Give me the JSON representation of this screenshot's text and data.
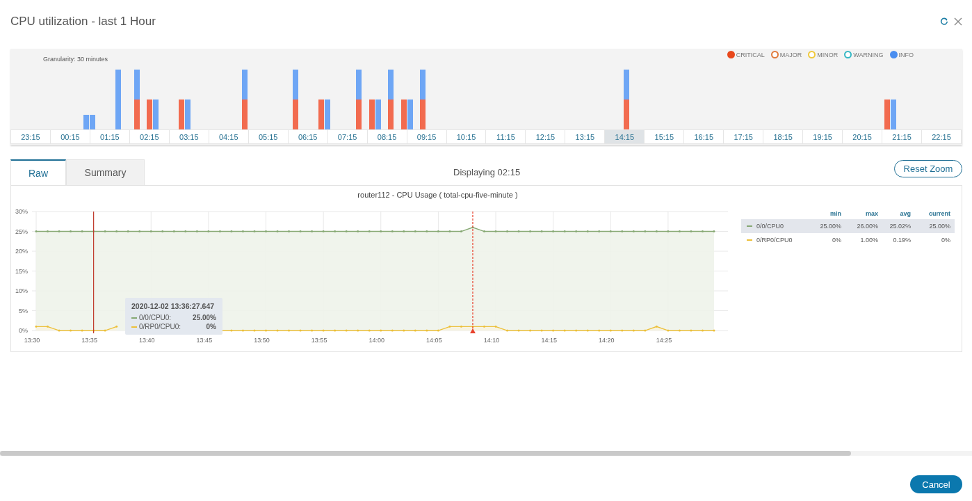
{
  "title": "CPU utilization - last 1 Hour",
  "histogram": {
    "granularity": "Granularity: 30 minutes",
    "legend": [
      {
        "label": "CRITICAL",
        "color": "#e8481c",
        "filled": true
      },
      {
        "label": "MAJOR",
        "color": "#e07a3c",
        "filled": false
      },
      {
        "label": "MINOR",
        "color": "#f0c93c",
        "filled": false
      },
      {
        "label": "WARNING",
        "color": "#35b8c4",
        "filled": false
      },
      {
        "label": "INFO",
        "color": "#4a8ef0",
        "filled": true
      }
    ],
    "slots": [
      {
        "label": "23:15",
        "selected": false
      },
      {
        "label": "00:15",
        "selected": false
      },
      {
        "label": "01:15",
        "selected": false
      },
      {
        "label": "02:15",
        "selected": false
      },
      {
        "label": "03:15",
        "selected": false
      },
      {
        "label": "04:15",
        "selected": false
      },
      {
        "label": "05:15",
        "selected": false
      },
      {
        "label": "06:15",
        "selected": false
      },
      {
        "label": "07:15",
        "selected": false
      },
      {
        "label": "08:15",
        "selected": false
      },
      {
        "label": "09:15",
        "selected": false
      },
      {
        "label": "10:15",
        "selected": false
      },
      {
        "label": "11:15",
        "selected": false
      },
      {
        "label": "12:15",
        "selected": false
      },
      {
        "label": "13:15",
        "selected": false
      },
      {
        "label": "14:15",
        "selected": true
      },
      {
        "label": "15:15",
        "selected": false
      },
      {
        "label": "16:15",
        "selected": false
      },
      {
        "label": "17:15",
        "selected": false
      },
      {
        "label": "18:15",
        "selected": false
      },
      {
        "label": "19:15",
        "selected": false
      },
      {
        "label": "20:15",
        "selected": false
      },
      {
        "label": "21:15",
        "selected": false
      },
      {
        "label": "22:15",
        "selected": false
      }
    ]
  },
  "tabs": [
    {
      "label": "Raw",
      "selected": true
    },
    {
      "label": "Summary",
      "selected": false
    }
  ],
  "displaying": "Displaying 02:15",
  "reset_button": "Reset Zoom",
  "chart": {
    "chart_data": {
      "type": "line",
      "title": "router112 - CPU Usage ( total-cpu-five-minute )",
      "categories": [
        "13:30",
        null,
        null,
        null,
        null,
        "13:35",
        null,
        null,
        null,
        null,
        "13:40",
        null,
        null,
        null,
        null,
        "13:45",
        null,
        null,
        null,
        null,
        "13:50",
        null,
        null,
        null,
        null,
        "13:55",
        null,
        null,
        null,
        null,
        "14:00",
        null,
        null,
        null,
        null,
        "14:05",
        null,
        null,
        null,
        null,
        "14:10",
        null,
        null,
        null,
        null,
        "14:15",
        null,
        null,
        null,
        null,
        "14:20",
        null,
        null,
        null,
        null,
        "14:25",
        null,
        null,
        null,
        null
      ],
      "series": [
        {
          "name": "0/0/CPU0",
          "color": "#86a873",
          "values": [
            25,
            25,
            25,
            25,
            25,
            25,
            25,
            25,
            25,
            25,
            25,
            25,
            25,
            25,
            25,
            25,
            25,
            25,
            25,
            25,
            25,
            25,
            25,
            25,
            25,
            25,
            25,
            25,
            25,
            25,
            25,
            25,
            25,
            25,
            25,
            25,
            25,
            25,
            26,
            25,
            25,
            25,
            25,
            25,
            25,
            25,
            25,
            25,
            25,
            25,
            25,
            25,
            25,
            25,
            25,
            25,
            25,
            25,
            25,
            25
          ]
        },
        {
          "name": "0/RP0/CPU0",
          "color": "#ecc03a",
          "values": [
            1,
            1,
            0,
            0,
            0,
            0,
            0,
            1,
            null,
            null,
            null,
            null,
            null,
            null,
            null,
            null,
            0,
            0,
            0,
            0,
            0,
            0,
            0,
            0,
            0,
            0,
            0,
            0,
            0,
            0,
            0,
            0,
            0,
            0,
            0,
            0,
            1,
            1,
            1,
            1,
            1,
            0,
            0,
            0,
            0,
            0,
            0,
            0,
            0,
            0,
            0,
            0,
            0,
            0,
            1,
            0,
            0,
            0,
            0,
            0
          ]
        }
      ],
      "ylim": [
        0,
        30
      ],
      "yticks": [
        {
          "value": 0,
          "label": "0%"
        },
        {
          "value": 5,
          "label": "5%"
        },
        {
          "value": 10,
          "label": "10%"
        },
        {
          "value": 15,
          "label": "15%"
        },
        {
          "value": 20,
          "label": "20%"
        },
        {
          "value": 25,
          "label": "25%"
        },
        {
          "value": 30,
          "label": "30%"
        }
      ],
      "grid": true
    },
    "tooltip": {
      "time": "2020-12-02 13:36:27.647",
      "rows": [
        {
          "name": "0/0/CPU0:",
          "value": "25.00%",
          "color": "#86a873"
        },
        {
          "name": "0/RP0/CPU0:",
          "value": "0%",
          "color": "#ecc03a"
        }
      ]
    },
    "legend": {
      "columns": [
        "min",
        "max",
        "avg",
        "current"
      ],
      "rows": [
        {
          "selected": true,
          "values": [
            "25.00%",
            "26.00%",
            "25.02%",
            "25.00%"
          ]
        },
        {
          "selected": false,
          "values": [
            "0%",
            "1.00%",
            "0.19%",
            "0%"
          ]
        }
      ]
    }
  },
  "cancel_button": "Cancel"
}
